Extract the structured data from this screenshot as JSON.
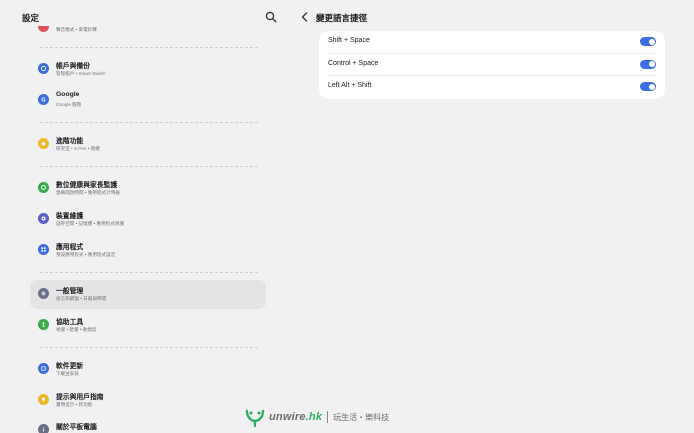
{
  "left": {
    "title": "設定",
    "top_partial_sub": "聲音模式 • 來電鈴聲",
    "items": [
      {
        "label": "帳戶與備份",
        "sub": "管理帳戶 • Smart Switch",
        "icon": "cloud-sync-icon",
        "color": "#3b6fe0"
      },
      {
        "label": "Google",
        "sub": "Google 服務",
        "icon": "google-icon",
        "color": "#3b6fe0"
      },
      {
        "label": "進階功能",
        "sub": "研究室 • S Pen • 側鍵",
        "icon": "star-icon",
        "color": "#f0b429"
      },
      {
        "label": "數位健康與家長監護",
        "sub": "螢幕開啟時間 • 應用程式計時器",
        "icon": "heart-icon",
        "color": "#3aa94a"
      },
      {
        "label": "裝置維護",
        "sub": "儲存空間 • 記憶體 • 應用程式保護",
        "icon": "device-care-icon",
        "color": "#5b5fc7"
      },
      {
        "label": "應用程式",
        "sub": "預設應用程式 • 應用程式設定",
        "icon": "apps-grid-icon",
        "color": "#3b6fe0"
      },
      {
        "label": "一般管理",
        "sub": "語言和鍵盤 • 日期與時間",
        "icon": "sliders-icon",
        "color": "#6a6f85"
      },
      {
        "label": "協助工具",
        "sub": "視覺 • 聽覺 • 敏捷度",
        "icon": "accessibility-icon",
        "color": "#3aa94a"
      },
      {
        "label": "軟件更新",
        "sub": "下載並安裝",
        "icon": "update-icon",
        "color": "#3b6fe0"
      },
      {
        "label": "提示與用戶指南",
        "sub": "實用提示 • 新功能",
        "icon": "lightbulb-icon",
        "color": "#f0b429"
      },
      {
        "label": "關於平板電腦",
        "sub": "",
        "icon": "info-icon",
        "color": "#6a6f85"
      }
    ]
  },
  "right": {
    "title": "變更語言捷徑",
    "shortcuts": [
      {
        "label": "Shift + Space",
        "enabled": true
      },
      {
        "label": "Control + Space",
        "enabled": true
      },
      {
        "label": "Left Alt + Shift",
        "enabled": true
      }
    ]
  },
  "watermark": {
    "brand_main": "unwire",
    "brand_suffix": ".hk",
    "slogan": "玩生活・樂科技",
    "brand_color": "#2fae5f"
  }
}
